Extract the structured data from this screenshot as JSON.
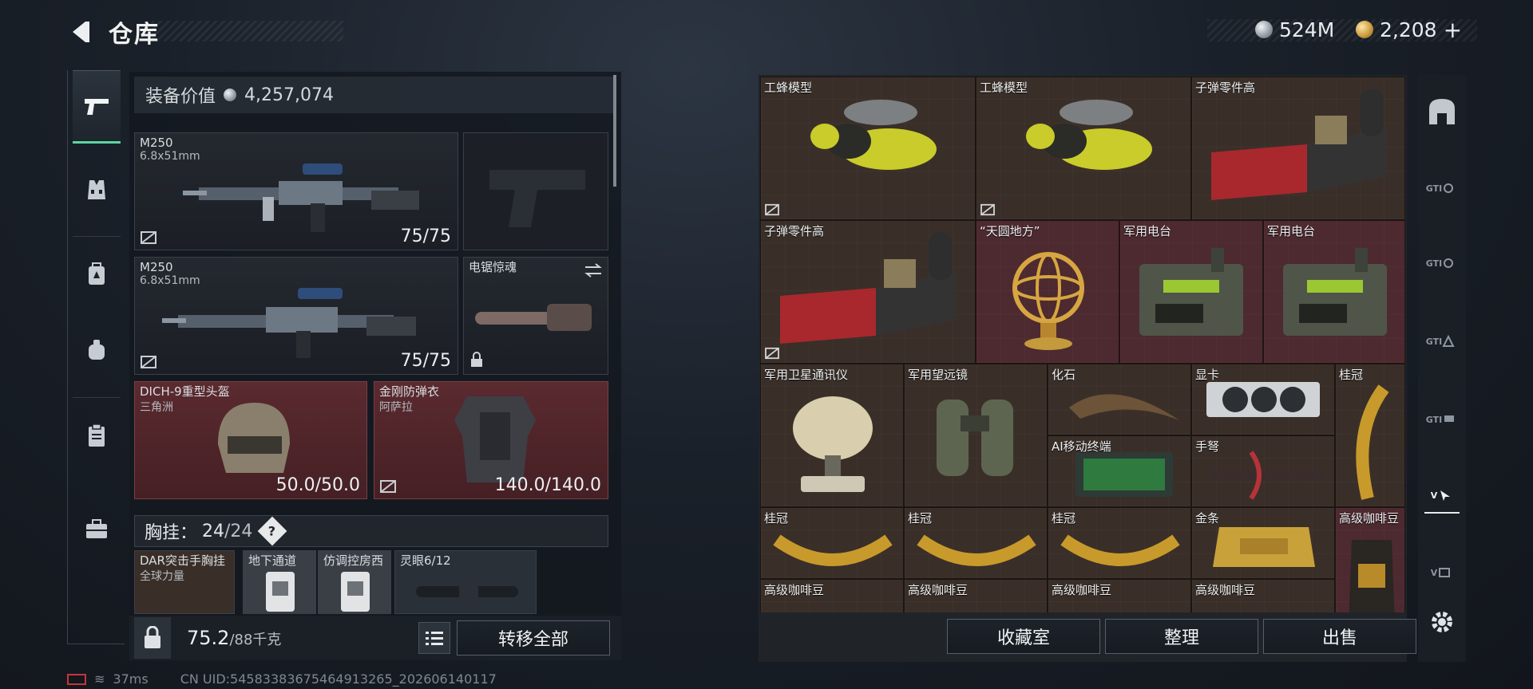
{
  "header": {
    "title": "仓库",
    "silver": "524M",
    "gold": "2,208",
    "plus": "+"
  },
  "loadout": {
    "value_label": "装备价值",
    "value": "4,257,074",
    "primary1": {
      "name": "M250",
      "caliber": "6.8x51mm",
      "durability": "75/75"
    },
    "primary2": {
      "name": "M250",
      "caliber": "6.8x51mm",
      "durability": "75/75"
    },
    "melee": {
      "name": "电锯惊魂"
    },
    "helmet": {
      "name": "DICH-9重型头盔",
      "sub": "三角洲",
      "durability": "50.0/50.0"
    },
    "armor": {
      "name": "金刚防弹衣",
      "sub": "阿萨拉",
      "durability": "140.0/140.0"
    },
    "chest": {
      "label": "胸挂：",
      "count": "24",
      "max": "/24"
    },
    "rig_items": [
      {
        "name": "DAR突击手胸挂",
        "sub": "全球力量"
      },
      {
        "name": "地下通道"
      },
      {
        "name": "仿调控房西"
      },
      {
        "name": "灵眼6/12"
      }
    ],
    "weight": "75.2",
    "weight_max": "/88千克",
    "transfer_all": "转移全部"
  },
  "stash": {
    "items": [
      {
        "name": "工蜂模型"
      },
      {
        "name": "工蜂模型"
      },
      {
        "name": "子弹零件高"
      },
      {
        "name": "子弹零件高"
      },
      {
        "name": "“天圆地方”"
      },
      {
        "name": "军用电台"
      },
      {
        "name": "军用电台"
      },
      {
        "name": "军用卫星通讯仪"
      },
      {
        "name": "军用望远镜"
      },
      {
        "name": "化石"
      },
      {
        "name": "显卡"
      },
      {
        "name": "桂冠"
      },
      {
        "name": "AI移动终端"
      },
      {
        "name": "手弩"
      },
      {
        "name": "桂冠"
      },
      {
        "name": "桂冠"
      },
      {
        "name": "桂冠"
      },
      {
        "name": "金条"
      },
      {
        "name": "高级咖啡豆"
      },
      {
        "name": "高级咖啡豆"
      },
      {
        "name": "高级咖啡豆"
      },
      {
        "name": "高级咖啡豆"
      },
      {
        "name": "高级咖啡豆"
      }
    ],
    "buttons": {
      "collection": "收藏室",
      "sort": "整理",
      "sell": "出售"
    }
  },
  "right_tabs": [
    "GTI",
    "GTI",
    "GTI",
    "GTI",
    "V",
    "V"
  ],
  "status": {
    "ping": "37ms",
    "uid": "CN UID:545833836754649132​65_202606140117"
  },
  "colors": {
    "accent": "#5fd3a1",
    "red_slot": "#4d2a30",
    "brown_slot": "#3a2f28"
  }
}
